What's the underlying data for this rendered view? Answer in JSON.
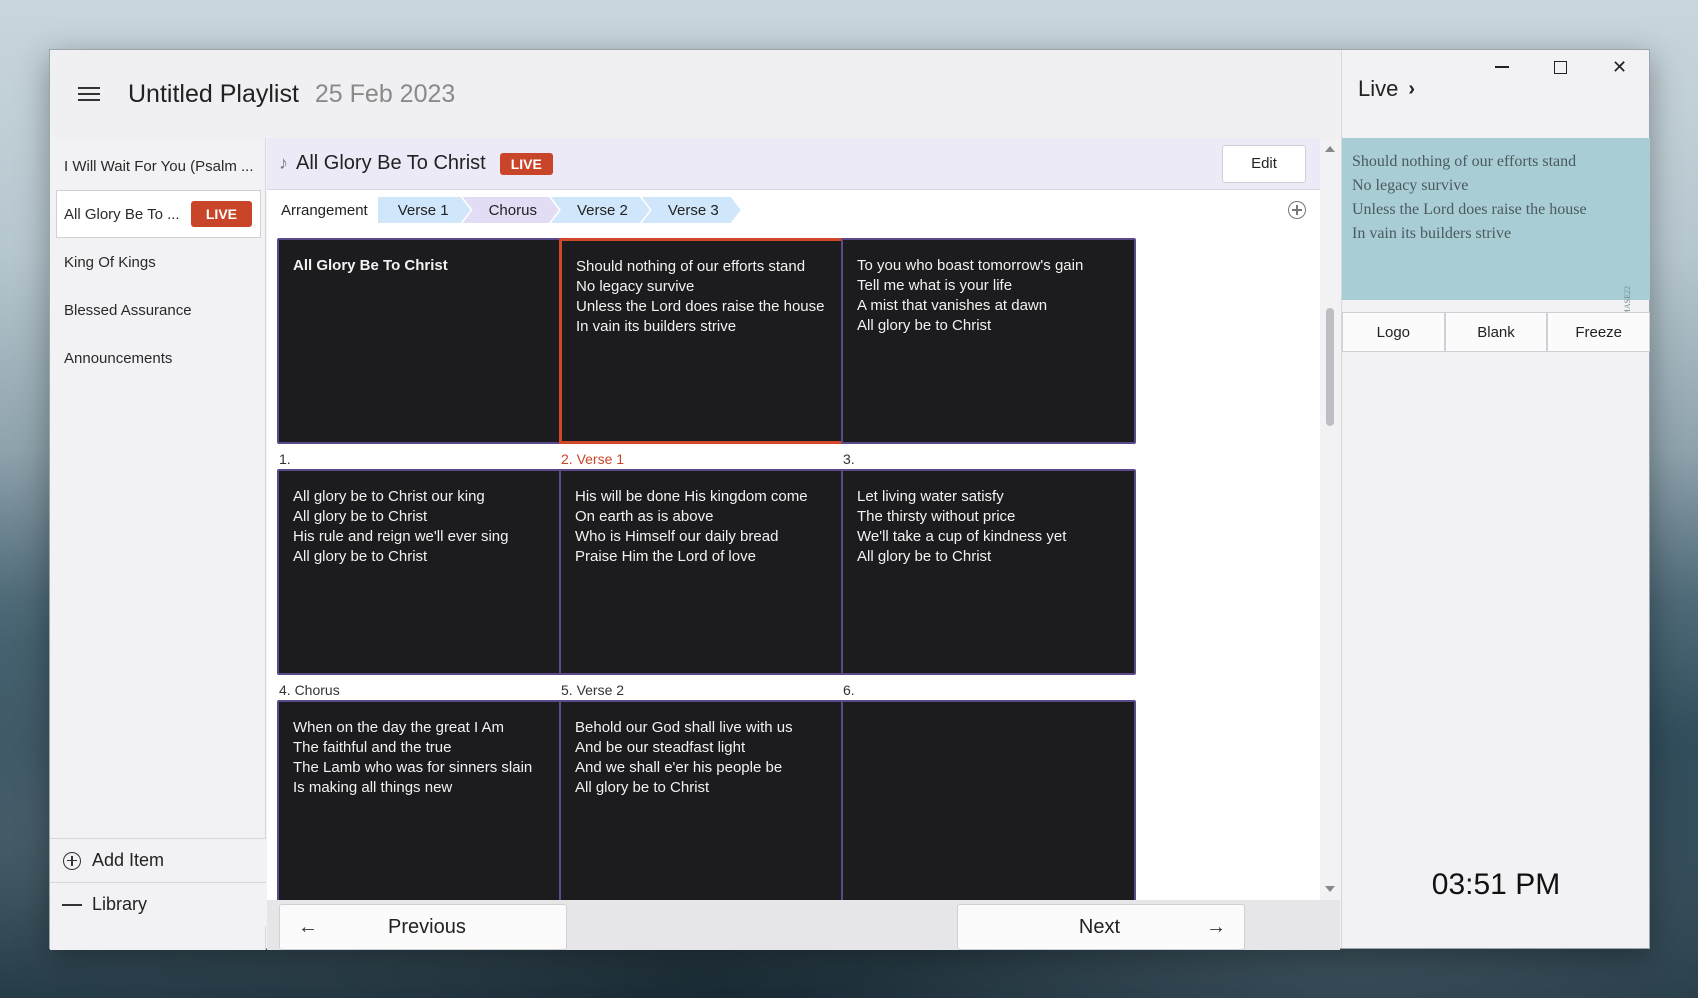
{
  "header": {
    "playlist_title": "Untitled Playlist",
    "playlist_date": "25 Feb 2023"
  },
  "sidebar": {
    "items": [
      {
        "label": "I Will Wait For You (Psalm ..."
      },
      {
        "label": "All Glory Be To ...",
        "badge": "LIVE"
      },
      {
        "label": "King Of Kings"
      },
      {
        "label": "Blessed Assurance"
      },
      {
        "label": "Announcements"
      }
    ],
    "add_item_label": "Add Item",
    "library_label": "Library"
  },
  "song": {
    "title": "All Glory Be To Christ",
    "badge": "LIVE",
    "edit_label": "Edit"
  },
  "arrangement": {
    "label": "Arrangement",
    "parts": [
      {
        "label": "Verse 1",
        "color": "#cfe6fb"
      },
      {
        "label": "Chorus",
        "color": "#e2dcf5"
      },
      {
        "label": "Verse 2",
        "color": "#cfe6fb"
      },
      {
        "label": "Verse 3",
        "color": "#cfe6fb"
      }
    ]
  },
  "slides": [
    {
      "text": "All Glory Be To Christ",
      "caption": "1.",
      "bold": true
    },
    {
      "text": "Should nothing of our efforts stand\nNo legacy survive\nUnless the Lord does raise the house\nIn vain its builders strive",
      "caption": "2. Verse 1",
      "selected": true
    },
    {
      "text": "To you who boast tomorrow's gain\nTell me what is your life\nA mist that vanishes at dawn\nAll glory be to Christ",
      "caption": "3."
    },
    {
      "text": "All glory be to Christ our king\nAll glory be to Christ\nHis rule and reign we'll ever sing\nAll glory be to Christ",
      "caption": "4. Chorus"
    },
    {
      "text": "His will be done His kingdom come\nOn earth as is above\nWho is Himself our daily bread\nPraise Him the Lord of love",
      "caption": "5. Verse 2"
    },
    {
      "text": "Let living water satisfy\nThe thirsty without price\nWe'll take a cup of kindness yet\nAll glory be to Christ",
      "caption": "6."
    },
    {
      "text": "When on the day the great I Am\nThe faithful and the true\nThe Lamb who was for sinners slain\nIs making all things new",
      "caption": ""
    },
    {
      "text": "Behold our God shall live with us\nAnd be our steadfast light\nAnd we shall e'er his people be\nAll glory be to Christ",
      "caption": ""
    },
    {
      "text": "",
      "caption": ""
    }
  ],
  "nav": {
    "previous_label": "Previous",
    "next_label": "Next"
  },
  "live": {
    "title": "Live",
    "preview_lines": [
      "Should nothing of our efforts stand",
      "No legacy survive",
      "Unless the Lord does raise the house",
      "In vain its builders strive"
    ],
    "preview_watermark": "#NoteMASE22",
    "buttons": {
      "logo": "Logo",
      "blank": "Blank",
      "freeze": "Freeze"
    },
    "clock": "03:51 PM"
  },
  "colors": {
    "live_badge": "#c8452a",
    "selected_border": "#d2472a",
    "slide_bg": "#1c1c1e",
    "slide_border": "#5b4a8a",
    "preview_bg": "#a9cdd4"
  }
}
